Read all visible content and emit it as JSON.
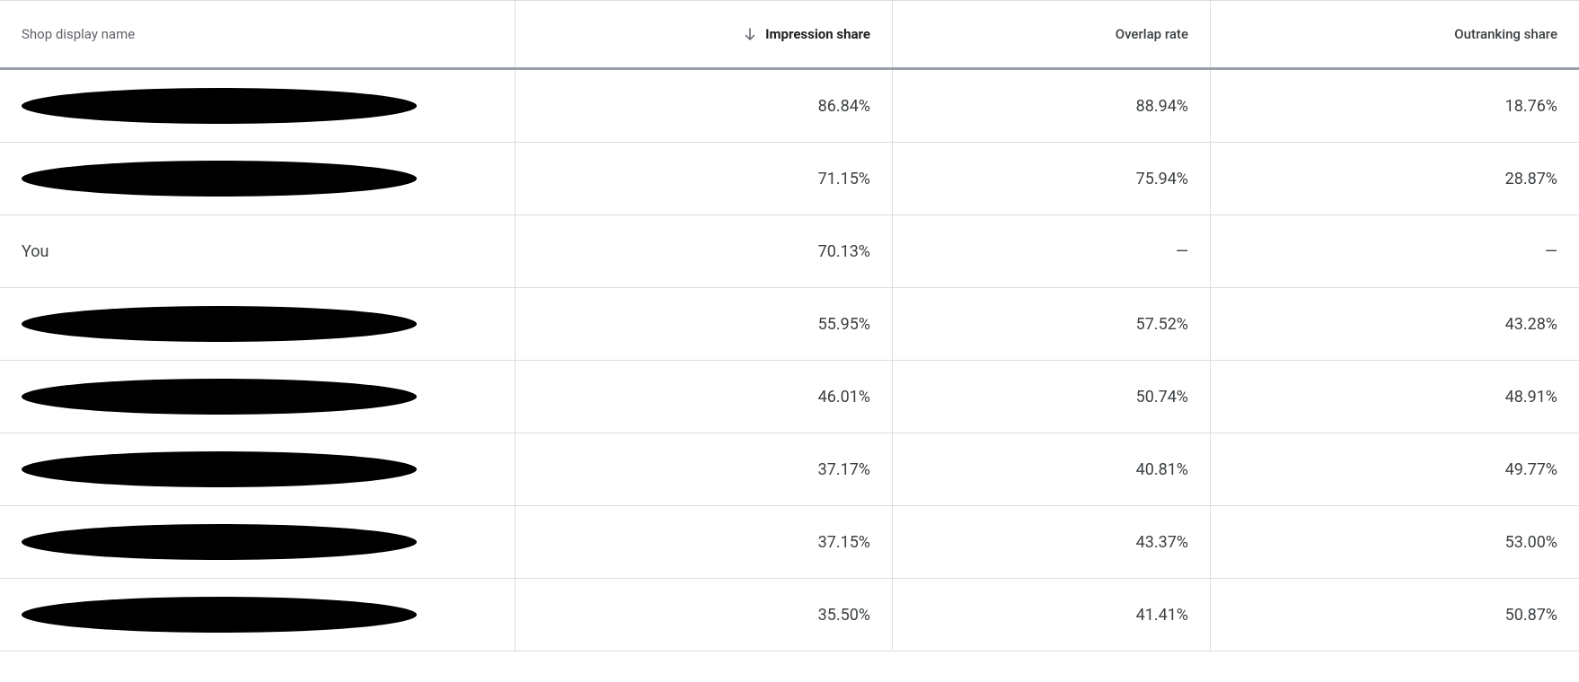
{
  "table": {
    "headers": {
      "name": "Shop display name",
      "impression": "Impression share",
      "overlap": "Overlap rate",
      "outranking": "Outranking share"
    },
    "sort": {
      "column": "impression",
      "direction": "desc"
    },
    "rows": [
      {
        "name_redacted": true,
        "name": "",
        "impression": "86.84%",
        "overlap": "88.94%",
        "outranking": "18.76%"
      },
      {
        "name_redacted": true,
        "name": "",
        "impression": "71.15%",
        "overlap": "75.94%",
        "outranking": "28.87%"
      },
      {
        "name_redacted": false,
        "name": "You",
        "impression": "70.13%",
        "overlap": "—",
        "outranking": "—"
      },
      {
        "name_redacted": true,
        "name": "",
        "impression": "55.95%",
        "overlap": "57.52%",
        "outranking": "43.28%"
      },
      {
        "name_redacted": true,
        "name": "",
        "impression": "46.01%",
        "overlap": "50.74%",
        "outranking": "48.91%"
      },
      {
        "name_redacted": true,
        "name": "",
        "impression": "37.17%",
        "overlap": "40.81%",
        "outranking": "49.77%"
      },
      {
        "name_redacted": true,
        "name": "",
        "impression": "37.15%",
        "overlap": "43.37%",
        "outranking": "53.00%"
      },
      {
        "name_redacted": true,
        "name": "",
        "impression": "35.50%",
        "overlap": "41.41%",
        "outranking": "50.87%"
      }
    ]
  }
}
